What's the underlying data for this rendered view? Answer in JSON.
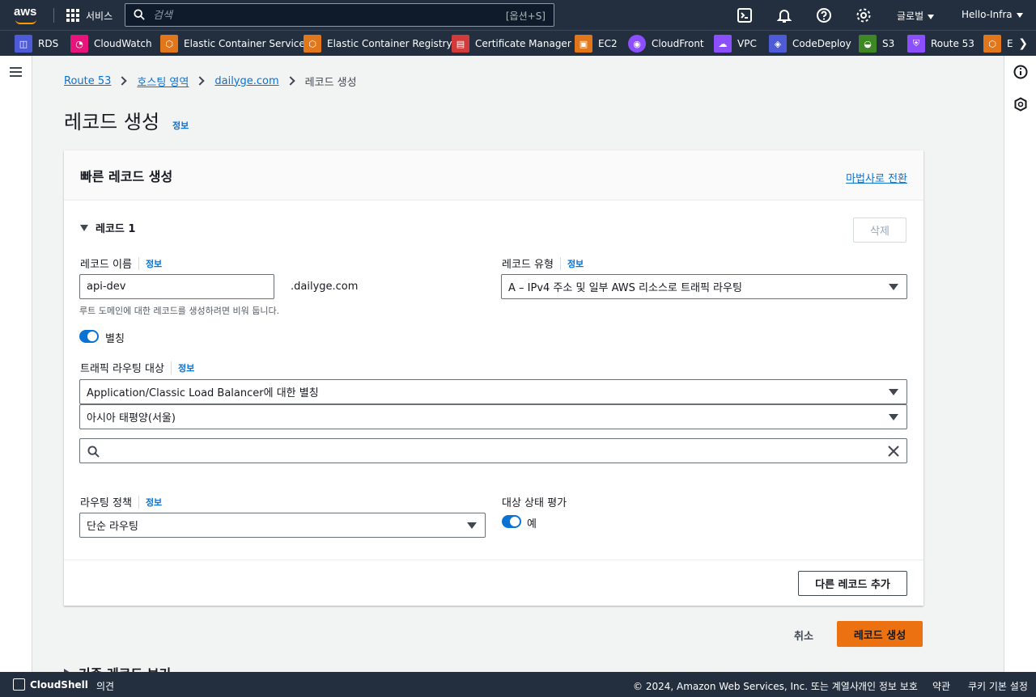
{
  "topnav": {
    "services": "서비스",
    "search_placeholder": "검색",
    "search_shortcut": "[옵션+S]",
    "region": "글로벌",
    "account": "Hello-Infra"
  },
  "favorites": [
    {
      "label": "RDS",
      "icon": "rds-icon",
      "color": "#4d5bd6"
    },
    {
      "label": "CloudWatch",
      "icon": "cloudwatch-icon",
      "color": "#e7157b"
    },
    {
      "label": "Elastic Container Service",
      "icon": "ecs-icon",
      "color": "#e2761a"
    },
    {
      "label": "Elastic Container Registry",
      "icon": "ecr-icon",
      "color": "#e2761a"
    },
    {
      "label": "Certificate Manager",
      "icon": "acm-icon",
      "color": "#d13b3b"
    },
    {
      "label": "EC2",
      "icon": "ec2-icon",
      "color": "#e2761a"
    },
    {
      "label": "CloudFront",
      "icon": "cloudfront-icon",
      "color": "#8c4fff"
    },
    {
      "label": "VPC",
      "icon": "vpc-icon",
      "color": "#8c4fff"
    },
    {
      "label": "CodeDeploy",
      "icon": "codedeploy-icon",
      "color": "#4d5bd6"
    },
    {
      "label": "S3",
      "icon": "s3-icon",
      "color": "#3f8624"
    },
    {
      "label": "Route 53",
      "icon": "route53-icon",
      "color": "#8c4fff"
    },
    {
      "label": "E",
      "icon": "service-icon",
      "color": "#e2761a"
    }
  ],
  "breadcrumb": {
    "items": [
      "Route 53",
      "호스팅 영역",
      "dailyge.com"
    ],
    "current": "레코드 생성"
  },
  "page": {
    "title": "레코드 생성",
    "info": "정보"
  },
  "card": {
    "title": "빠른 레코드 생성",
    "wizard_link": "마법사로 전환",
    "record_heading": "레코드 1",
    "delete_label": "삭제",
    "record_name_label": "레코드 이름",
    "record_name_info": "정보",
    "record_name_value": "api-dev",
    "record_name_suffix": ".dailyge.com",
    "record_name_hint": "루트 도메인에 대한 레코드를 생성하려면 비워 둡니다.",
    "record_type_label": "레코드 유형",
    "record_type_info": "정보",
    "record_type_value": "A – IPv4 주소 및 일부 AWS 리소스로 트래픽 라우팅",
    "alias_label": "별칭",
    "alias_on": true,
    "traffic_target_label": "트래픽 라우팅 대상",
    "traffic_target_info": "정보",
    "endpoint_value": "Application/Classic Load Balancer에 대한 별칭",
    "region_value": "아시아 태평양(서울)",
    "lb_search_value": "",
    "routing_policy_label": "라우팅 정책",
    "routing_policy_info": "정보",
    "routing_policy_value": "단순 라우팅",
    "health_eval_label": "대상 상태 평가",
    "health_eval_value": "예",
    "health_eval_on": true,
    "add_record_label": "다른 레코드 추가"
  },
  "actions": {
    "cancel": "취소",
    "create": "레코드 생성"
  },
  "partial_section": "기존 레코드 보기",
  "bottombar": {
    "cloudshell": "CloudShell",
    "feedback": "의견",
    "copyright": "© 2024, Amazon Web Services, Inc. 또는 계열사.",
    "privacy": "개인 정보 보호",
    "terms": "약관",
    "cookies": "쿠키 기본 설정"
  }
}
